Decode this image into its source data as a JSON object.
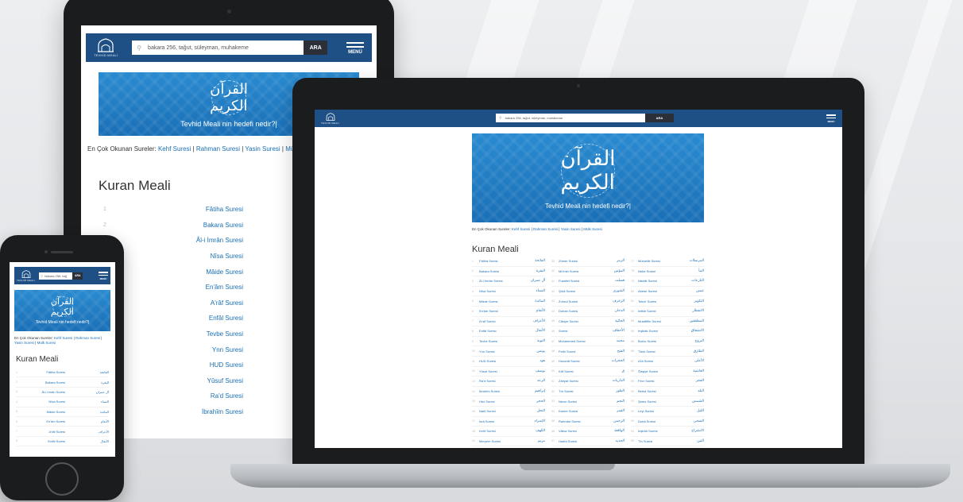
{
  "brand": {
    "logo_text": "TEVHİD MEALİ"
  },
  "search": {
    "placeholder": "bakara 256, tağut, süleyman, muhakeme",
    "placeholder_short": "bakara 256, tağ",
    "button": "ARA"
  },
  "menu_label": "MENÜ",
  "banner": {
    "calligraphy": "القرآن الكريم",
    "tagline": "Tevhid Meali nin hedefi nedir?|"
  },
  "popular": {
    "label": "En Çok Okunan Sureler:",
    "links": [
      "Kehf Suresi",
      "Rahman Suresi",
      "Yasin Suresi",
      "Mülk Suresi"
    ],
    "links_tablet": [
      "Kehf Suresi",
      "Rahman Suresi",
      "Yasin Suresi",
      "Mülk S"
    ]
  },
  "page_title": "Kuran Meali",
  "tablet_list": [
    {
      "no": "1",
      "name": "Fâtiha Suresi"
    },
    {
      "no": "2",
      "name": "Bakara Suresi"
    },
    {
      "no": "3",
      "name": "Âl-i İmrân Suresi"
    },
    {
      "no": "",
      "name": "Nîsa Suresi"
    },
    {
      "no": "",
      "name": "Mâide Suresi"
    },
    {
      "no": "",
      "name": "En'âm Suresi"
    },
    {
      "no": "",
      "name": "A'râf Suresi"
    },
    {
      "no": "",
      "name": "Enfâl Suresi"
    },
    {
      "no": "",
      "name": "Tevbe Suresi"
    },
    {
      "no": "",
      "name": "Ynn Suresi"
    },
    {
      "no": "",
      "name": "HUD Suresi"
    },
    {
      "no": "",
      "name": "Yûsuf Suresi"
    },
    {
      "no": "",
      "name": "Ra'd Suresi"
    },
    {
      "no": "",
      "name": "İbrahîm Suresi"
    }
  ],
  "phone_list": [
    {
      "no": "1",
      "name": "Fâtiha Suresi",
      "ar": "الفاتحة"
    },
    {
      "no": "2",
      "name": "Bakara Suresi",
      "ar": "البقرة"
    },
    {
      "no": "3",
      "name": "Âl-i İmrân Suresi",
      "ar": "آل عمران"
    },
    {
      "no": "4",
      "name": "Nîsa Suresi",
      "ar": "النساء"
    },
    {
      "no": "5",
      "name": "Mâide Suresi",
      "ar": "المائدة"
    },
    {
      "no": "6",
      "name": "En'âm Suresi",
      "ar": "الأنعام"
    },
    {
      "no": "7",
      "name": "A'râf Suresi",
      "ar": "الأعراف"
    },
    {
      "no": "8",
      "name": "Enfâl Suresi",
      "ar": "الأنفال"
    }
  ],
  "laptop_cols": [
    [
      {
        "no": "1",
        "name": "Fâtiha Suresi",
        "ar": "الفاتحة"
      },
      {
        "no": "2",
        "name": "Bakara Suresi",
        "ar": "البقرة"
      },
      {
        "no": "3",
        "name": "Âl-i İmrân Suresi",
        "ar": "آل عمران"
      },
      {
        "no": "4",
        "name": "Nîsa Suresi",
        "ar": "النساء"
      },
      {
        "no": "5",
        "name": "Mâide Suresi",
        "ar": "المائدة"
      },
      {
        "no": "6",
        "name": "En'âm Suresi",
        "ar": "الأنعام"
      },
      {
        "no": "7",
        "name": "A'râf Suresi",
        "ar": "الأعراف"
      },
      {
        "no": "8",
        "name": "Enfâl Suresi",
        "ar": "الأنفال"
      },
      {
        "no": "9",
        "name": "Tevbe Suresi",
        "ar": "التوبة"
      },
      {
        "no": "10",
        "name": "Ynn Suresi",
        "ar": "يونس"
      },
      {
        "no": "11",
        "name": "HUD Suresi",
        "ar": "هود"
      },
      {
        "no": "12",
        "name": "Yûsuf Suresi",
        "ar": "يوسف"
      },
      {
        "no": "13",
        "name": "Ra'd Suresi",
        "ar": "الرعد"
      },
      {
        "no": "14",
        "name": "İbrahîm Suresi",
        "ar": "إبراهيم"
      },
      {
        "no": "15",
        "name": "Hicr Suresi",
        "ar": "الحجر"
      },
      {
        "no": "16",
        "name": "Nahl Suresi",
        "ar": "النحل"
      },
      {
        "no": "17",
        "name": "İsrâ Suresi",
        "ar": "الإسراء"
      },
      {
        "no": "18",
        "name": "Kehf Suresi",
        "ar": "الكهف"
      },
      {
        "no": "19",
        "name": "Meryem Suresi",
        "ar": "مريم"
      },
      {
        "no": "20",
        "name": "Suresi",
        "ar": "طه"
      },
      {
        "no": "21",
        "name": "Enbiyâ Suresi",
        "ar": "الأنبياء"
      }
    ],
    [
      {
        "no": "39",
        "name": "Zümer Suresi",
        "ar": "الزمر"
      },
      {
        "no": "40",
        "name": "Mü'min Suresi",
        "ar": "المؤمن"
      },
      {
        "no": "41",
        "name": "Fussilet Suresi",
        "ar": "فصلت"
      },
      {
        "no": "42",
        "name": "Şûrâ Suresi",
        "ar": "الشورى"
      },
      {
        "no": "43",
        "name": "Zuhruf Suresi",
        "ar": "الزخرف"
      },
      {
        "no": "44",
        "name": "Duhan Suresi",
        "ar": "الدخان"
      },
      {
        "no": "45",
        "name": "Câsiye Suresi",
        "ar": "الجاثية"
      },
      {
        "no": "46",
        "name": "Suresi",
        "ar": "الأحقاف"
      },
      {
        "no": "47",
        "name": "Muhammed Suresi",
        "ar": "محمد"
      },
      {
        "no": "48",
        "name": "Fetih Suresi",
        "ar": "الفتح"
      },
      {
        "no": "49",
        "name": "Hucurât Suresi",
        "ar": "الحجرات"
      },
      {
        "no": "50",
        "name": "Kâf Suresi",
        "ar": "ق"
      },
      {
        "no": "51",
        "name": "Zâriyat Suresi",
        "ar": "الذاريات"
      },
      {
        "no": "52",
        "name": "Tûr Suresi",
        "ar": "الطور"
      },
      {
        "no": "53",
        "name": "Necm Suresi",
        "ar": "النجم"
      },
      {
        "no": "54",
        "name": "Kamer Suresi",
        "ar": "القمر"
      },
      {
        "no": "55",
        "name": "Rahmân Suresi",
        "ar": "الرحمن"
      },
      {
        "no": "56",
        "name": "Vâkıa Suresi",
        "ar": "الواقعة"
      },
      {
        "no": "57",
        "name": "Hadîd Suresi",
        "ar": "الحديد"
      },
      {
        "no": "58",
        "name": "Mücadele Suresi",
        "ar": "المجادلة"
      },
      {
        "no": "59",
        "name": "Haşr Suresi",
        "ar": "الحشر"
      }
    ],
    [
      {
        "no": "77",
        "name": "Mürselât Suresi",
        "ar": "المرسلات"
      },
      {
        "no": "78",
        "name": "Nebe Suresi",
        "ar": "النبأ"
      },
      {
        "no": "79",
        "name": "Nâziât Suresi",
        "ar": "النازعات"
      },
      {
        "no": "80",
        "name": "Abese Suresi",
        "ar": "عبس"
      },
      {
        "no": "81",
        "name": "Tekvîr Suresi",
        "ar": "التكوير"
      },
      {
        "no": "82",
        "name": "İnfitâr Suresi",
        "ar": "الانفطار"
      },
      {
        "no": "83",
        "name": "Mutaffifîn Suresi",
        "ar": "المطففين"
      },
      {
        "no": "84",
        "name": "İnşikâk Suresi",
        "ar": "الانشقاق"
      },
      {
        "no": "85",
        "name": "Burûc Suresi",
        "ar": "البروج"
      },
      {
        "no": "86",
        "name": "Târık Suresi",
        "ar": "الطارق"
      },
      {
        "no": "87",
        "name": "A'lâ Suresi",
        "ar": "الأعلى"
      },
      {
        "no": "88",
        "name": "Ğaşiye Suresi",
        "ar": "الغاشية"
      },
      {
        "no": "89",
        "name": "Fecr Suresi",
        "ar": "الفجر"
      },
      {
        "no": "90",
        "name": "Beled Suresi",
        "ar": "البلد"
      },
      {
        "no": "91",
        "name": "Şems Suresi",
        "ar": "الشمس"
      },
      {
        "no": "92",
        "name": "Leyl Suresi",
        "ar": "الليل"
      },
      {
        "no": "93",
        "name": "Duhâ Suresi",
        "ar": "الضحى"
      },
      {
        "no": "94",
        "name": "İnşirâh Suresi",
        "ar": "الانشراح"
      },
      {
        "no": "95",
        "name": "Tîn Suresi",
        "ar": "التين"
      },
      {
        "no": "96",
        "name": "Alak Suresi",
        "ar": "العلق"
      },
      {
        "no": "97",
        "name": "Suresi",
        "ar": "القدر"
      }
    ]
  ],
  "colors": {
    "header": "#1e4f85",
    "banner": "#1a6fb6",
    "link": "#1a6fb6",
    "button": "#2a2f38"
  }
}
